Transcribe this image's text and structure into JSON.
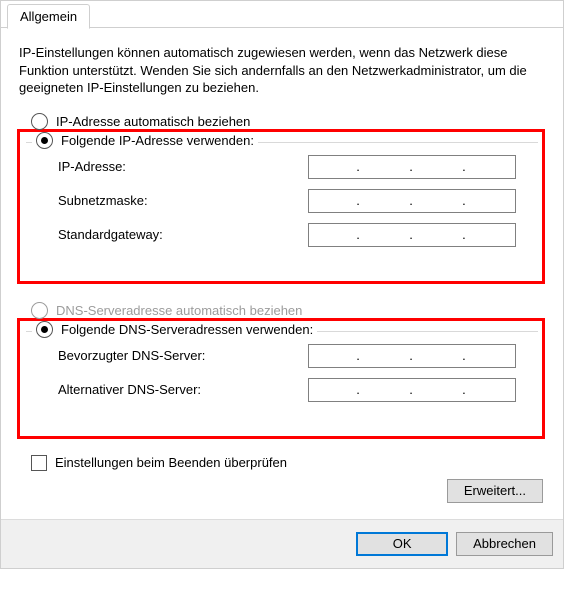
{
  "tab_label": "Allgemein",
  "description": "IP-Einstellungen können automatisch zugewiesen werden, wenn das Netzwerk diese Funktion unterstützt. Wenden Sie sich andernfalls an den Netzwerkadministrator, um die geeigneten IP-Einstellungen zu beziehen.",
  "ip": {
    "auto_label": "IP-Adresse automatisch beziehen",
    "manual_label": "Folgende IP-Adresse verwenden:",
    "selected": "manual",
    "fields": {
      "address_label": "IP-Adresse:",
      "subnet_label": "Subnetzmaske:",
      "gateway_label": "Standardgateway:",
      "address_value": "",
      "subnet_value": "",
      "gateway_value": ""
    }
  },
  "dns": {
    "auto_label": "DNS-Serveradresse automatisch beziehen",
    "auto_enabled": false,
    "manual_label": "Folgende DNS-Serveradressen verwenden:",
    "selected": "manual",
    "fields": {
      "preferred_label": "Bevorzugter DNS-Server:",
      "alternate_label": "Alternativer DNS-Server:",
      "preferred_value": "",
      "alternate_value": ""
    }
  },
  "validate_on_exit_label": "Einstellungen beim Beenden überprüfen",
  "validate_on_exit_checked": false,
  "advanced_button": "Erweitert...",
  "ok_button": "OK",
  "cancel_button": "Abbrechen"
}
